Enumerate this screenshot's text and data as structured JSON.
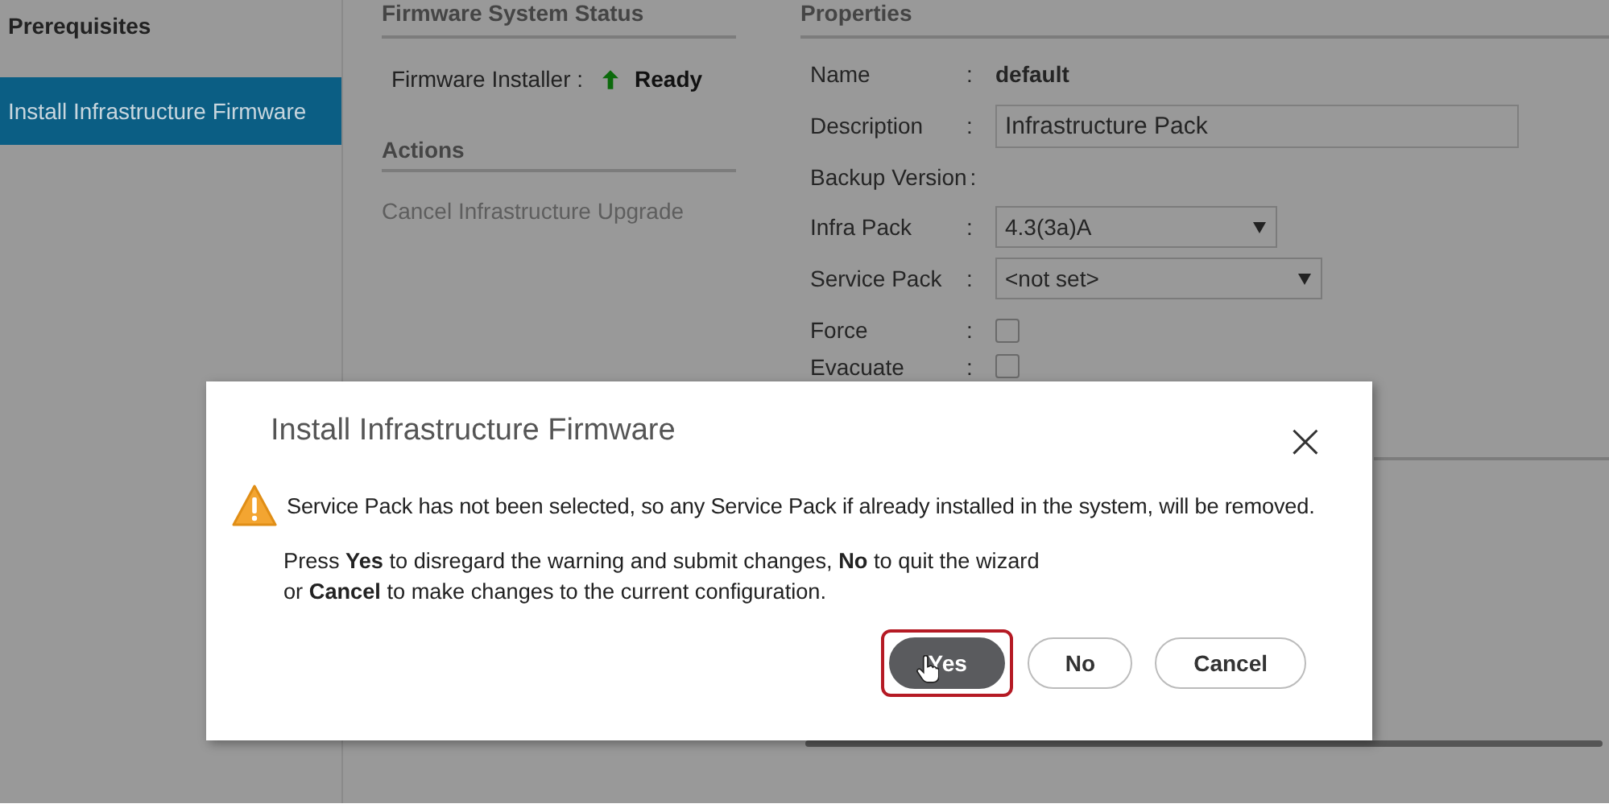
{
  "sidebar": {
    "title": "Prerequisites",
    "items": [
      {
        "label": "Install Infrastructure Firmware",
        "selected": true
      }
    ]
  },
  "status": {
    "title": "Firmware System Status",
    "label": "Firmware Installer :",
    "value": "Ready"
  },
  "actions": {
    "title": "Actions",
    "items": [
      {
        "label": "Cancel Infrastructure Upgrade",
        "disabled": true
      }
    ]
  },
  "properties": {
    "title": "Properties",
    "rows": [
      {
        "kind": "text",
        "label": "Name",
        "separator": ":",
        "value": "default"
      },
      {
        "kind": "field",
        "label": "Description",
        "separator": ":",
        "value": "Infrastructure Pack"
      },
      {
        "kind": "empty",
        "label": "Backup Version",
        "separator": ":"
      },
      {
        "kind": "select",
        "label": "Infra Pack",
        "separator": ":",
        "value": "4.3(3a)A"
      },
      {
        "kind": "select",
        "label": "Service Pack",
        "separator": ":",
        "value": "<not set>"
      },
      {
        "kind": "checkbox",
        "label": "Force",
        "separator": ":",
        "checked": false
      },
      {
        "kind": "checkbox",
        "label": "Evacuate",
        "separator": ":",
        "checked": false
      }
    ]
  },
  "dialog": {
    "title": "Install Infrastructure Firmware",
    "close": "×",
    "warning": "Service Pack has not been selected, so any Service Pack if already installed in the system, will be removed.",
    "instructions": [
      "Press **Yes** to disregard the warning and submit changes, **No** to quit the wizard",
      "or **Cancel** to make changes to the current configuration."
    ],
    "buttons": [
      {
        "label": "Yes",
        "selected": true
      },
      {
        "label": "No",
        "selected": false
      },
      {
        "label": "Cancel",
        "selected": false
      }
    ]
  }
}
